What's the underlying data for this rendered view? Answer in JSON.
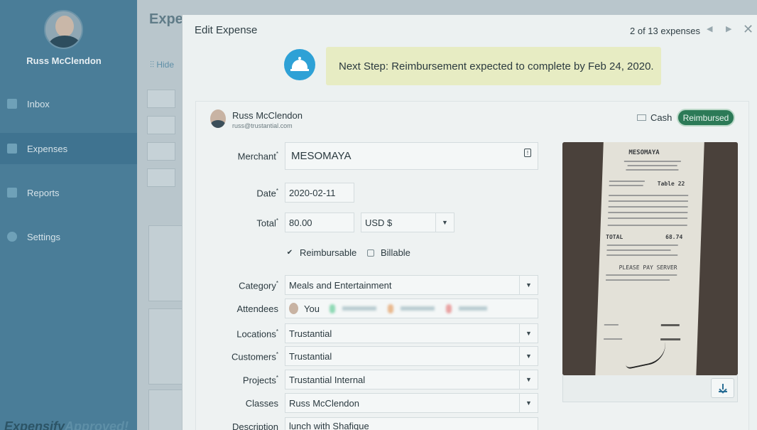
{
  "sidebar": {
    "user_name": "Russ McClendon",
    "items": [
      {
        "label": "Inbox",
        "icon": "inbox-icon"
      },
      {
        "label": "Expenses",
        "icon": "expenses-icon"
      },
      {
        "label": "Reports",
        "icon": "reports-icon"
      },
      {
        "label": "Settings",
        "icon": "settings-icon"
      }
    ],
    "active_item": "Expenses",
    "brand_a": "Expensify",
    "brand_b": "Approved!"
  },
  "background": {
    "title": "Expe",
    "hide_label": "Hide"
  },
  "modal": {
    "title": "Edit Expense",
    "pager_text": "2 of 13 expenses",
    "next_step_label": "Next Step:",
    "next_step_text": "Reimbursement expected to complete by Feb 24, 2020."
  },
  "submitter": {
    "name": "Russ McClendon",
    "email": "russ@trustantial.com",
    "payment_type": "Cash",
    "status": "Reimbursed"
  },
  "form": {
    "merchant_label": "Merchant",
    "merchant_value": "MESOMAYA",
    "date_label": "Date",
    "date_value": "2020-02-11",
    "total_label": "Total",
    "total_value": "80.00",
    "currency_value": "USD $",
    "reimbursable_label": "Reimbursable",
    "reimbursable_checked": true,
    "billable_label": "Billable",
    "billable_checked": false,
    "category_label": "Category",
    "category_value": "Meals and Entertainment",
    "attendees_label": "Attendees",
    "attendee_self": "You",
    "locations_label": "Locations",
    "locations_value": "Trustantial",
    "customers_label": "Customers",
    "customers_value": "Trustantial",
    "projects_label": "Projects",
    "projects_value": "Trustantial Internal",
    "classes_label": "Classes",
    "classes_value": "Russ McClendon",
    "description_label": "Description",
    "description_value": "lunch with Shafique"
  },
  "receipt": {
    "merchant": "MESOMAYA",
    "table": "Table 22",
    "total_label": "TOTAL",
    "total_value": "68.74",
    "footer": "PLEASE PAY SERVER"
  },
  "colors": {
    "sidebar_bg": "#4a7d98",
    "modal_bg": "#ecf1f1",
    "status_green": "#2c7a57",
    "next_step_bg": "#e7ecc3",
    "bell_blue": "#2ea1d6"
  }
}
